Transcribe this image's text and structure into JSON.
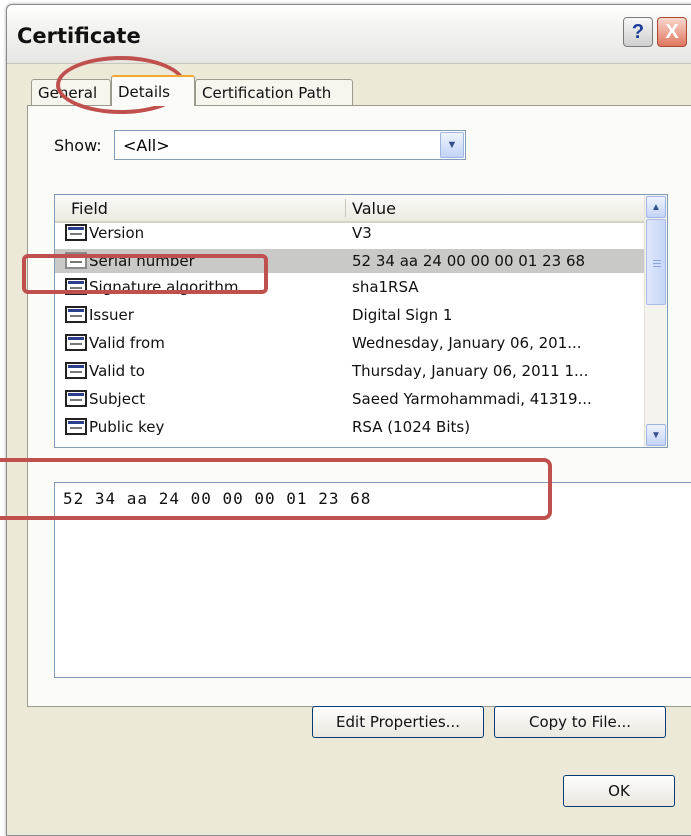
{
  "window": {
    "title": "Certificate",
    "help_label": "?",
    "close_label": "X"
  },
  "tabs": [
    {
      "label": "General",
      "selected": false
    },
    {
      "label": "Details",
      "selected": true
    },
    {
      "label": "Certification Path",
      "selected": false
    }
  ],
  "show": {
    "label": "Show:",
    "value": "<All>"
  },
  "list": {
    "columns": [
      "Field",
      "Value"
    ],
    "rows": [
      {
        "field": "Version",
        "value": "V3"
      },
      {
        "field": "Serial number",
        "value": "52 34 aa 24 00 00 00 01 23 68",
        "selected": true
      },
      {
        "field": "Signature algorithm",
        "value": "sha1RSA"
      },
      {
        "field": "Issuer",
        "value": "Digital Sign 1"
      },
      {
        "field": "Valid from",
        "value": "Wednesday, January 06, 201..."
      },
      {
        "field": "Valid to",
        "value": "Thursday, January 06, 2011 1..."
      },
      {
        "field": "Subject",
        "value": "Saeed Yarmohammadi, 41319..."
      },
      {
        "field": "Public key",
        "value": "RSA (1024 Bits)"
      }
    ]
  },
  "detail": {
    "text": "52 34 aa 24 00 00 00 01 23 68"
  },
  "buttons": {
    "edit_properties": "Edit Properties...",
    "copy_to_file": "Copy to File...",
    "ok": "OK"
  },
  "annotation_color": "#c0504d"
}
